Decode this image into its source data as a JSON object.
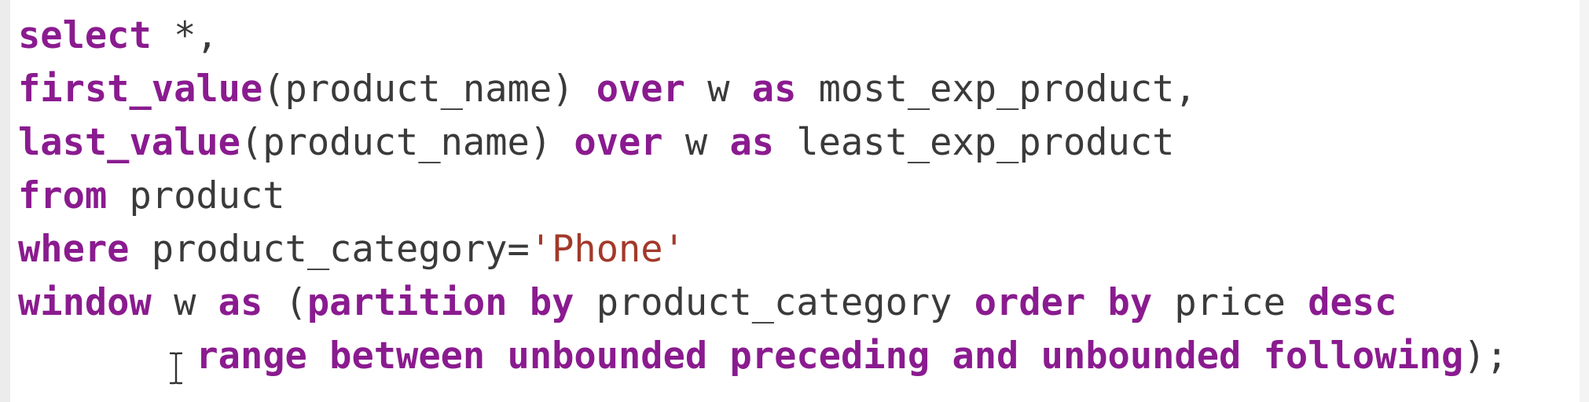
{
  "editor": {
    "lines": [
      [
        {
          "t": "select",
          "c": "kw"
        },
        {
          "t": " *,",
          "c": "plain"
        }
      ],
      [
        {
          "t": "first_value",
          "c": "kw"
        },
        {
          "t": "(product_name) ",
          "c": "plain"
        },
        {
          "t": "over",
          "c": "kw"
        },
        {
          "t": " w ",
          "c": "plain"
        },
        {
          "t": "as",
          "c": "kw"
        },
        {
          "t": " most_exp_product,",
          "c": "plain"
        }
      ],
      [
        {
          "t": "last_value",
          "c": "kw"
        },
        {
          "t": "(product_name) ",
          "c": "plain"
        },
        {
          "t": "over",
          "c": "kw"
        },
        {
          "t": " w ",
          "c": "plain"
        },
        {
          "t": "as",
          "c": "kw"
        },
        {
          "t": " least_exp_product",
          "c": "plain"
        }
      ],
      [
        {
          "t": "from",
          "c": "kw"
        },
        {
          "t": " product",
          "c": "plain"
        }
      ],
      [
        {
          "t": "where",
          "c": "kw"
        },
        {
          "t": " product_category=",
          "c": "plain"
        },
        {
          "t": "'Phone'",
          "c": "str"
        }
      ],
      [
        {
          "t": "window",
          "c": "kw"
        },
        {
          "t": " w ",
          "c": "plain"
        },
        {
          "t": "as",
          "c": "kw"
        },
        {
          "t": " (",
          "c": "plain"
        },
        {
          "t": "partition",
          "c": "kw"
        },
        {
          "t": " ",
          "c": "plain"
        },
        {
          "t": "by",
          "c": "kw"
        },
        {
          "t": " product_category ",
          "c": "plain"
        },
        {
          "t": "order",
          "c": "kw"
        },
        {
          "t": " ",
          "c": "plain"
        },
        {
          "t": "by",
          "c": "kw"
        },
        {
          "t": " price ",
          "c": "plain"
        },
        {
          "t": "desc",
          "c": "kw"
        }
      ],
      [
        {
          "t": "        ",
          "c": "plain"
        },
        {
          "t": "range",
          "c": "kw"
        },
        {
          "t": " ",
          "c": "plain"
        },
        {
          "t": "between",
          "c": "kw"
        },
        {
          "t": " ",
          "c": "plain"
        },
        {
          "t": "unbounded",
          "c": "kw"
        },
        {
          "t": " ",
          "c": "plain"
        },
        {
          "t": "preceding",
          "c": "kw"
        },
        {
          "t": " ",
          "c": "plain"
        },
        {
          "t": "and",
          "c": "kw"
        },
        {
          "t": " ",
          "c": "plain"
        },
        {
          "t": "unbounded",
          "c": "kw"
        },
        {
          "t": " ",
          "c": "plain"
        },
        {
          "t": "following",
          "c": "kw"
        },
        {
          "t": ");",
          "c": "plain"
        }
      ]
    ]
  },
  "cursor_icon": "i-beam-cursor-icon",
  "colors": {
    "keyword": "#8a1b8f",
    "plain": "#3a3a3a",
    "string": "#a3392a",
    "background": "#ffffff"
  }
}
